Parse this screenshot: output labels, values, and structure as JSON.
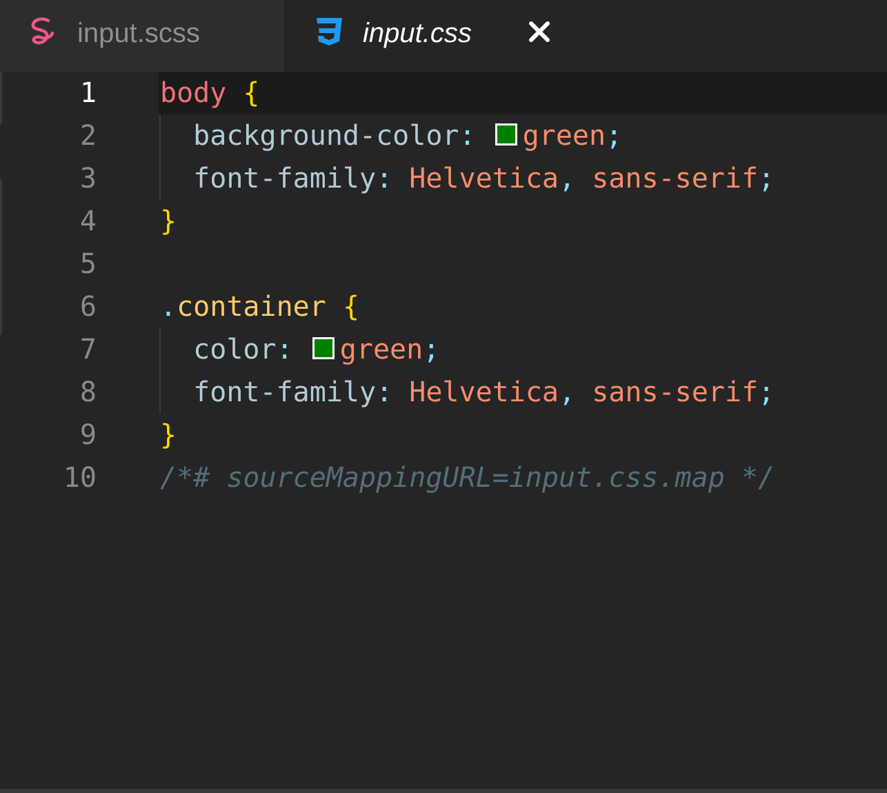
{
  "tabs": [
    {
      "label": "input.scss",
      "icon": "sass-icon",
      "active": false
    },
    {
      "label": "input.css",
      "icon": "css3-icon",
      "active": true
    }
  ],
  "colors": {
    "sass": "#f0568c",
    "css": "#1e9bf0",
    "swatch_green": "#008000"
  },
  "editor": {
    "current_line": 1,
    "lines": [
      {
        "n": "1",
        "t": [
          [
            "sel",
            "body"
          ],
          [
            "plain",
            " "
          ],
          [
            "brace",
            "{"
          ]
        ]
      },
      {
        "n": "2",
        "t": [
          [
            "plain",
            "  "
          ],
          [
            "prop",
            "background-color"
          ],
          [
            "punct",
            ":"
          ],
          [
            "plain",
            " "
          ],
          [
            "swatch",
            ""
          ],
          [
            "val",
            "green"
          ],
          [
            "punct",
            ";"
          ]
        ]
      },
      {
        "n": "3",
        "t": [
          [
            "plain",
            "  "
          ],
          [
            "prop",
            "font-family"
          ],
          [
            "punct",
            ":"
          ],
          [
            "plain",
            " "
          ],
          [
            "val",
            "Helvetica"
          ],
          [
            "punct",
            ","
          ],
          [
            "plain",
            " "
          ],
          [
            "val",
            "sans-serif"
          ],
          [
            "punct",
            ";"
          ]
        ]
      },
      {
        "n": "4",
        "t": [
          [
            "brace",
            "}"
          ]
        ]
      },
      {
        "n": "5",
        "t": []
      },
      {
        "n": "6",
        "t": [
          [
            "dot",
            "."
          ],
          [
            "cls",
            "container"
          ],
          [
            "plain",
            " "
          ],
          [
            "brace",
            "{"
          ]
        ]
      },
      {
        "n": "7",
        "t": [
          [
            "plain",
            "  "
          ],
          [
            "prop",
            "color"
          ],
          [
            "punct",
            ":"
          ],
          [
            "plain",
            " "
          ],
          [
            "swatch",
            ""
          ],
          [
            "val",
            "green"
          ],
          [
            "punct",
            ";"
          ]
        ]
      },
      {
        "n": "8",
        "t": [
          [
            "plain",
            "  "
          ],
          [
            "prop",
            "font-family"
          ],
          [
            "punct",
            ":"
          ],
          [
            "plain",
            " "
          ],
          [
            "val",
            "Helvetica"
          ],
          [
            "punct",
            ","
          ],
          [
            "plain",
            " "
          ],
          [
            "val",
            "sans-serif"
          ],
          [
            "punct",
            ";"
          ]
        ]
      },
      {
        "n": "9",
        "t": [
          [
            "brace",
            "}"
          ]
        ]
      },
      {
        "n": "10",
        "t": [
          [
            "comment",
            "/*# sourceMappingURL=input.css.map */"
          ]
        ]
      }
    ]
  }
}
